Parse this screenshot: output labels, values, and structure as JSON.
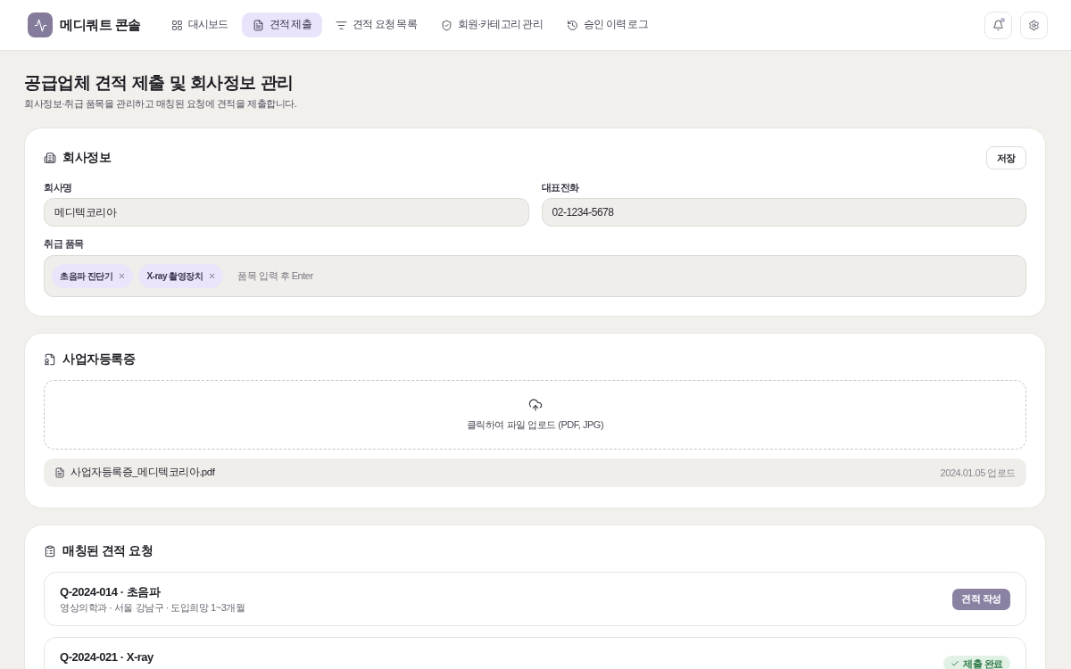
{
  "app": {
    "name": "메디쿼트 콘솔"
  },
  "nav": [
    {
      "label": "대시보드",
      "selected": false
    },
    {
      "label": "견적 제출",
      "selected": true
    },
    {
      "label": "견적 요청 목록",
      "selected": false
    },
    {
      "label": "회원·카테고리 관리",
      "selected": false
    },
    {
      "label": "승인 이력 로그",
      "selected": false
    }
  ],
  "header": {
    "notifications": {
      "unread": true
    }
  },
  "page": {
    "title": "공급업체 견적 제출 및 회사정보 관리",
    "subtitle": "회사정보·취급 품목을 관리하고 매칭된 요청에 견적을 제출합니다."
  },
  "company_info": {
    "title": "회사정보",
    "save_button": "저장",
    "fields": [
      {
        "label": "회사명",
        "value": "메디텍코리아"
      },
      {
        "label": "대표전화",
        "value": "02-1234-5678"
      }
    ],
    "items": {
      "label": "취급 품목",
      "tags": [
        {
          "label": "초음파 진단기"
        },
        {
          "label": "X-ray 촬영장치"
        }
      ],
      "placeholder": "품목 입력 후 Enter"
    }
  },
  "business_license": {
    "title": "사업자등록증",
    "upload_hint": "클릭하여 파일 업로드 (PDF, JPG)",
    "file": {
      "name": "사업자등록증_메디텍코리아.pdf",
      "uploaded": "2024.01.05 업로드"
    }
  },
  "matched_requests": {
    "title": "매칭된 견적 요청",
    "items": [
      {
        "title": "Q-2024-014 · 초음파",
        "subtitle": "영상의학과 · 서울 강남구 · 도입희망 1~3개월",
        "kind": "pending",
        "label": "견적 작성"
      },
      {
        "title": "Q-2024-021 · X-ray",
        "kind": "submitted",
        "label": "제출 완료"
      }
    ]
  }
}
